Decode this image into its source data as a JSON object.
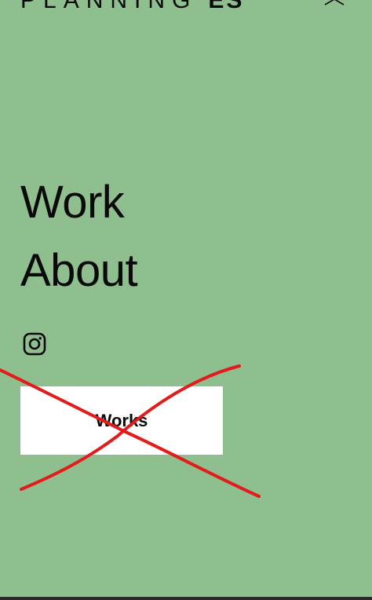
{
  "header": {
    "brand_light": "PLANNING",
    "brand_bold": "ES"
  },
  "icons": {
    "close": "close-icon",
    "instagram": "instagram-icon"
  },
  "nav": {
    "items": [
      {
        "label": "Work"
      },
      {
        "label": "About"
      }
    ]
  },
  "cta": {
    "label": "Works"
  },
  "colors": {
    "background": "#8fbe8f",
    "button_bg": "#ffffff",
    "text": "#0a0a0a",
    "annotation_cross": "#e31b1b"
  }
}
